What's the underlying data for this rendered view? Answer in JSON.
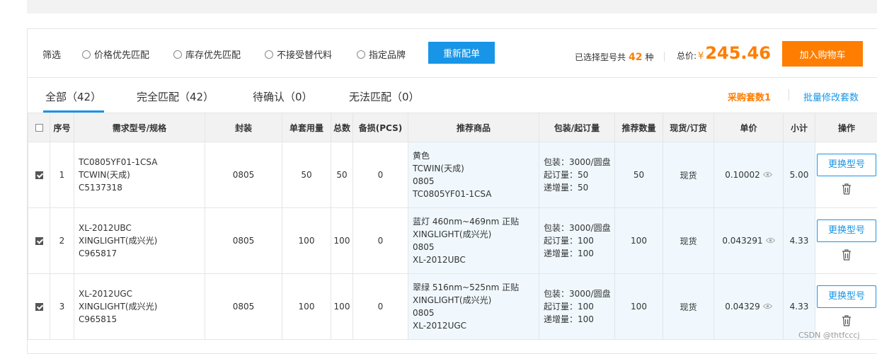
{
  "filter": {
    "label": "筛选",
    "options": [
      "价格优先匹配",
      "库存优先匹配",
      "不接受替代料",
      "指定品牌"
    ],
    "rematch_label": "重新配单",
    "selected_prefix": "已选择型号共",
    "selected_count": "42",
    "selected_suffix": "种",
    "total_label": "总价:",
    "currency": "¥",
    "total_amount": "245.46",
    "cart_label": "加入购物车"
  },
  "tabs": {
    "items": [
      "全部（42）",
      "完全匹配（42）",
      "待确认（0）",
      "无法匹配（0）"
    ],
    "sets_label": "采购套数1",
    "batch_label": "批量修改套数"
  },
  "table": {
    "headers": [
      "序号",
      "需求型号/规格",
      "封装",
      "单套用量",
      "总数",
      "备损(PCS)",
      "推荐商品",
      "包装/起订量",
      "推荐数量",
      "现货/订货",
      "单价",
      "小计",
      "操作"
    ],
    "swap_label": "更换型号",
    "rows": [
      {
        "index": "1",
        "spec": [
          "TC0805YF01-1CSA",
          "TCWIN(天成)",
          "C5137318"
        ],
        "package": "0805",
        "per_set": "50",
        "total": "50",
        "spare": "0",
        "product": [
          "黄色",
          "TCWIN(天成)",
          "0805",
          "TC0805YF01-1CSA"
        ],
        "packing": [
          "包装：3000/圆盘",
          "起订量：50",
          "递增量：50"
        ],
        "rec_qty": "50",
        "stock": "现货",
        "price": "0.10002",
        "subtotal": "5.00"
      },
      {
        "index": "2",
        "spec": [
          "XL-2012UBC",
          "XINGLIGHT(成兴光)",
          "C965817"
        ],
        "package": "0805",
        "per_set": "100",
        "total": "100",
        "spare": "0",
        "product": [
          "蓝灯 460nm~469nm 正贴",
          "XINGLIGHT(成兴光)",
          "0805",
          "XL-2012UBC"
        ],
        "packing": [
          "包装：3000/圆盘",
          "起订量：100",
          "递增量：100"
        ],
        "rec_qty": "100",
        "stock": "现货",
        "price": "0.043291",
        "subtotal": "4.33"
      },
      {
        "index": "3",
        "spec": [
          "XL-2012UGC",
          "XINGLIGHT(成兴光)",
          "C965815"
        ],
        "package": "0805",
        "per_set": "100",
        "total": "100",
        "spare": "0",
        "product": [
          "翠绿 516nm~525nm 正贴",
          "XINGLIGHT(成兴光)",
          "0805",
          "XL-2012UGC"
        ],
        "packing": [
          "包装：3000/圆盘",
          "起订量：100",
          "递增量：100"
        ],
        "rec_qty": "100",
        "stock": "现货",
        "price": "0.04329",
        "subtotal": "4.33"
      }
    ]
  },
  "watermark": "CSDN @thtfcccj"
}
